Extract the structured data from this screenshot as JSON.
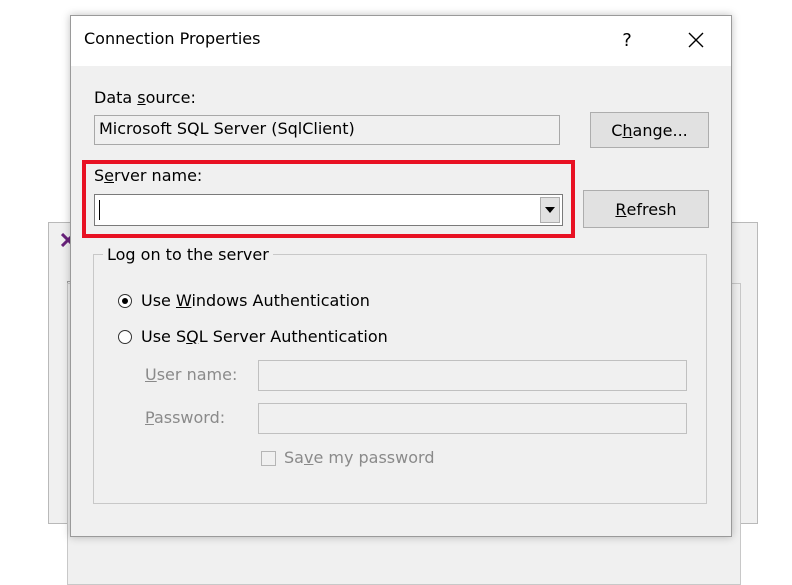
{
  "dialog": {
    "title": "Connection Properties",
    "help_label": "?",
    "close_label": "✕"
  },
  "data_source": {
    "label_pre": "Data ",
    "label_mnemonic": "s",
    "label_post": "ource:",
    "value": "Microsoft SQL Server (SqlClient)",
    "change_pre": "C",
    "change_mnemonic": "h",
    "change_post": "ange..."
  },
  "server_name": {
    "label_pre": "S",
    "label_mnemonic": "e",
    "label_post": "rver name:",
    "value": "",
    "refresh_mnemonic": "R",
    "refresh_post": "efresh"
  },
  "logon": {
    "legend": "Log on to the server",
    "windows_auth_pre": "Use ",
    "windows_auth_mnemonic": "W",
    "windows_auth_post": "indows Authentication",
    "sql_auth_pre": "Use S",
    "sql_auth_mnemonic": "Q",
    "sql_auth_post": "L Server Authentication",
    "selected": "windows",
    "username_mnemonic": "U",
    "username_post": "ser name:",
    "username_value": "",
    "password_mnemonic": "P",
    "password_post": "assword:",
    "password_value": "",
    "save_pre": "Sa",
    "save_mnemonic": "v",
    "save_post": "e my password",
    "save_checked": false
  },
  "colors": {
    "highlight": "#e81123",
    "dialog_bg": "#f0f0f0"
  }
}
